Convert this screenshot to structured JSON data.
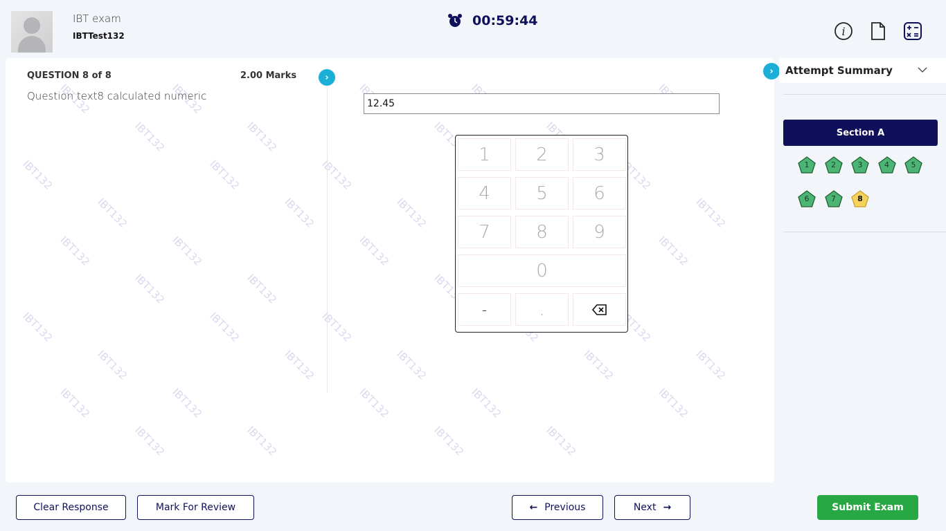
{
  "header": {
    "exam_name": "IBT exam",
    "username": "IBTTest132",
    "timer": "00:59:44",
    "icons": [
      "info-icon",
      "document-icon",
      "calculator-icon"
    ]
  },
  "question": {
    "label": "QUESTION 8 of 8",
    "marks": "2.00 Marks",
    "text": "Question text8 calculated numeric",
    "answer": "12.45"
  },
  "keypad": {
    "keys": [
      "1",
      "2",
      "3",
      "4",
      "5",
      "6",
      "7",
      "8",
      "9",
      "0",
      "-",
      "."
    ],
    "backspace_icon": "backspace-icon"
  },
  "watermark": "IBT132",
  "summary": {
    "title": "Attempt Summary",
    "section": "Section A",
    "questions": [
      {
        "n": "1",
        "status": "answered"
      },
      {
        "n": "2",
        "status": "answered"
      },
      {
        "n": "3",
        "status": "answered"
      },
      {
        "n": "4",
        "status": "answered"
      },
      {
        "n": "5",
        "status": "answered"
      },
      {
        "n": "6",
        "status": "answered"
      },
      {
        "n": "7",
        "status": "answered"
      },
      {
        "n": "8",
        "status": "current"
      }
    ]
  },
  "colors": {
    "answered": "#4cb576",
    "current": "#f5d25c",
    "navy": "#10105a",
    "accent": "#1bafd7",
    "submit": "#28a745"
  },
  "footer": {
    "clear": "Clear Response",
    "review": "Mark For Review",
    "previous": "Previous",
    "next": "Next",
    "submit": "Submit Exam"
  }
}
